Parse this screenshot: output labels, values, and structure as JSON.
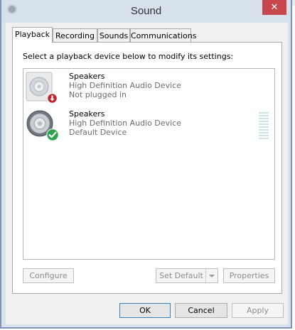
{
  "window": {
    "title": "Sound",
    "close_glyph": "✕"
  },
  "tabs": [
    {
      "label": "Playback",
      "active": true
    },
    {
      "label": "Recording",
      "active": false
    },
    {
      "label": "Sounds",
      "active": false
    },
    {
      "label": "Communications",
      "active": false
    }
  ],
  "playback": {
    "instruction": "Select a playback device below to modify its settings:",
    "devices": [
      {
        "name": "Speakers",
        "driver": "High Definition Audio Device",
        "status": "Not plugged in",
        "icon": "speaker-disabled-icon",
        "badge": "red-unplugged-badge"
      },
      {
        "name": "Speakers",
        "driver": "High Definition Audio Device",
        "status": "Default Device",
        "icon": "speaker-icon",
        "badge": "green-check-badge"
      }
    ],
    "buttons": {
      "configure": "Configure",
      "set_default": "Set Default",
      "properties": "Properties"
    }
  },
  "footer": {
    "ok": "OK",
    "cancel": "Cancel",
    "apply": "Apply"
  },
  "colors": {
    "accent": "#3c7fb1",
    "close": "#c7474d",
    "title_bg": "#d7e1ec",
    "ok_badge": "#2aa34a",
    "error_badge": "#c0282d"
  }
}
